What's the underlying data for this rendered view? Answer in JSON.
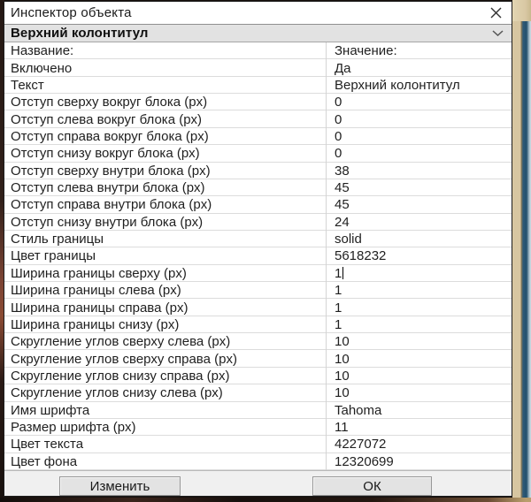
{
  "window": {
    "title": "Инспектор объекта"
  },
  "selector": {
    "value": "Верхний колонтитул"
  },
  "table": {
    "headers": {
      "name": "Название:",
      "value": "Значение:"
    },
    "rows": [
      {
        "name": "Включено",
        "value": "Да"
      },
      {
        "name": "Текст",
        "value": "Верхний колонтитул"
      },
      {
        "name": "Отступ сверху вокруг блока (px)",
        "value": "0"
      },
      {
        "name": "Отступ слева вокруг блока (px)",
        "value": "0"
      },
      {
        "name": "Отступ справа вокруг блока (px)",
        "value": "0"
      },
      {
        "name": "Отступ снизу вокруг блока (px)",
        "value": "0"
      },
      {
        "name": "Отступ сверху внутри блока (px)",
        "value": "38"
      },
      {
        "name": "Отступ слева внутри блока (px)",
        "value": "45"
      },
      {
        "name": "Отступ справа внутри блока (px)",
        "value": "45"
      },
      {
        "name": "Отступ снизу внутри блока (px)",
        "value": "24"
      },
      {
        "name": "Стиль границы",
        "value": "solid"
      },
      {
        "name": "Цвет границы",
        "value": "5618232"
      },
      {
        "name": "Ширина границы сверху (px)",
        "value": "1",
        "editing": true
      },
      {
        "name": "Ширина границы слева (px)",
        "value": "1"
      },
      {
        "name": "Ширина границы справа (px)",
        "value": "1"
      },
      {
        "name": "Ширина границы снизу (px)",
        "value": "1"
      },
      {
        "name": "Скругление углов сверху слева (px)",
        "value": "10"
      },
      {
        "name": "Скругление углов сверху справа (px)",
        "value": "10"
      },
      {
        "name": "Скругление углов снизу справа (px)",
        "value": "10"
      },
      {
        "name": "Скругление углов снизу слева (px)",
        "value": "10"
      },
      {
        "name": "Имя шрифта",
        "value": "Tahoma"
      },
      {
        "name": "Размер шрифта (px)",
        "value": "11"
      },
      {
        "name": "Цвет текста",
        "value": "4227072"
      },
      {
        "name": "Цвет фона",
        "value": "12320699"
      }
    ]
  },
  "footer": {
    "edit_button": "Изменить",
    "ok_button": "ОК"
  },
  "icons": {
    "close": "✕",
    "chevron_down": "⌄"
  },
  "colors": {
    "window_bg": "#ffffff",
    "selector_bg": "#e2e2e2",
    "footer_bg": "#f0f0f0",
    "grid_line": "#dcdcdc",
    "button_bg": "#e3e3e3"
  }
}
